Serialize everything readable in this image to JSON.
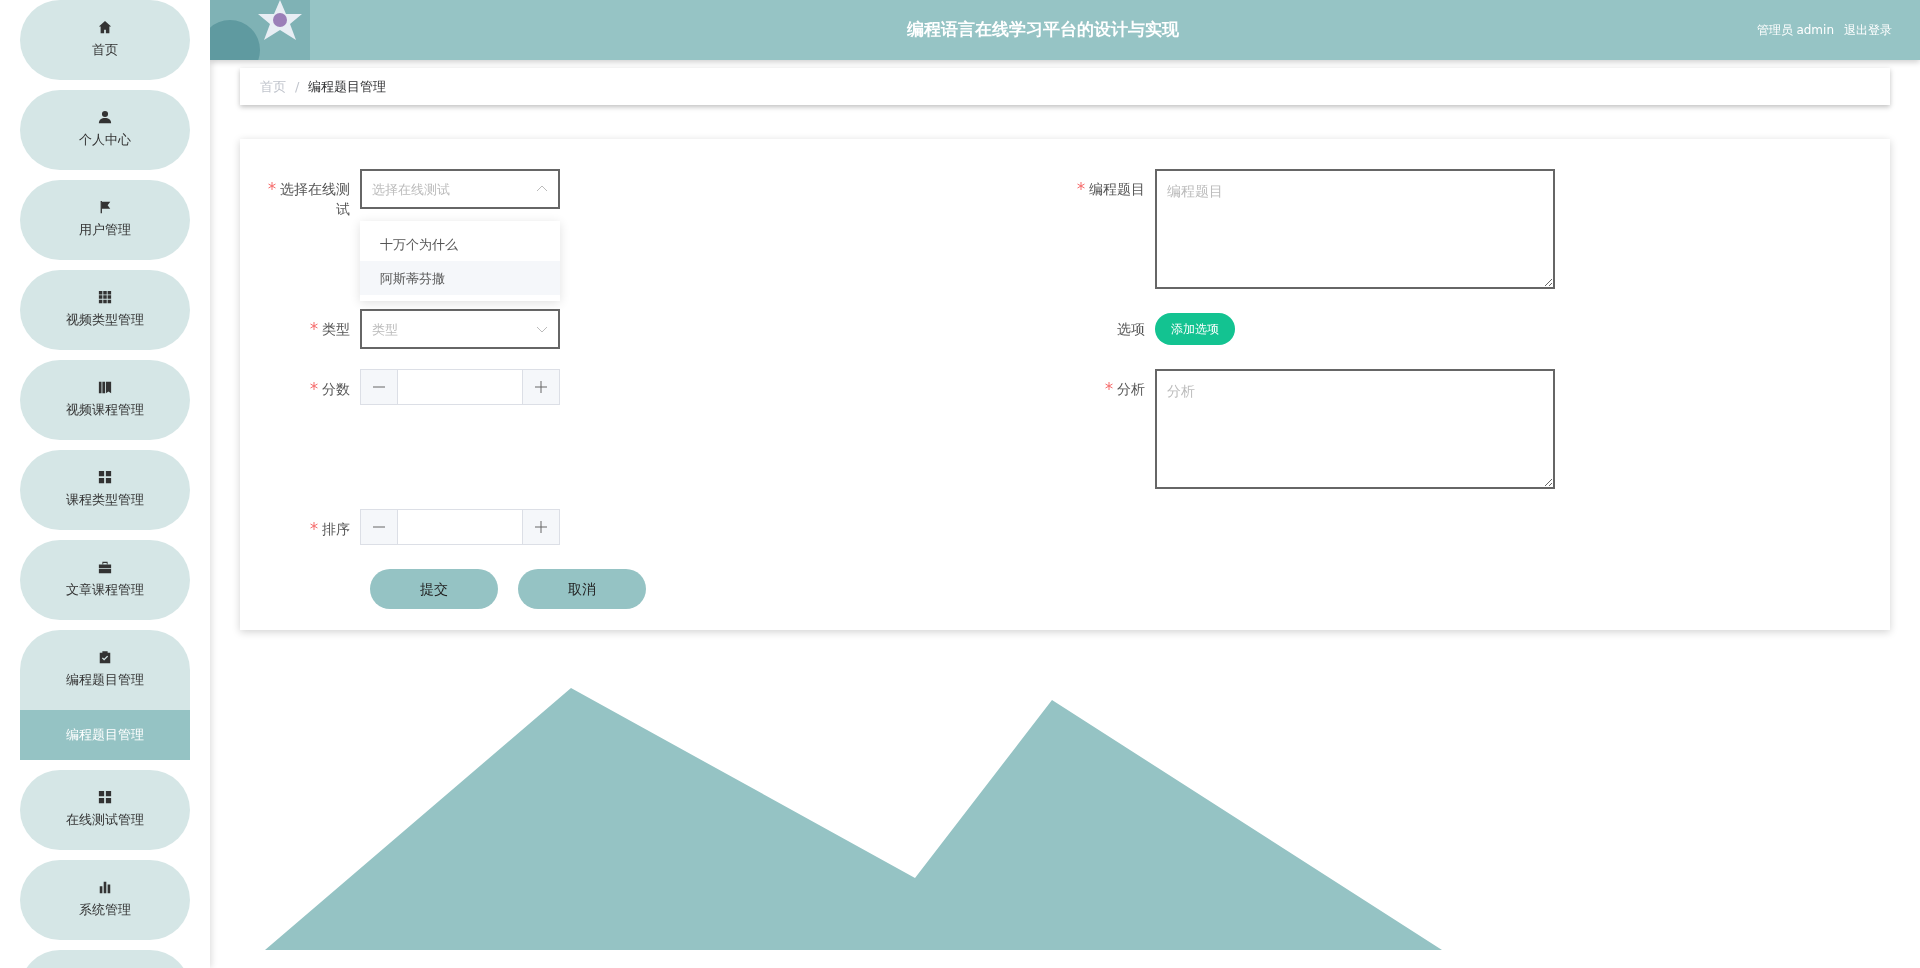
{
  "header": {
    "title": "编程语言在线学习平台的设计与实现",
    "user": "管理员 admin",
    "logout": "退出登录"
  },
  "sidebar": {
    "items": [
      {
        "label": "首页",
        "expanded": false
      },
      {
        "label": "个人中心",
        "expanded": false
      },
      {
        "label": "用户管理",
        "expanded": false
      },
      {
        "label": "视频类型管理",
        "expanded": false
      },
      {
        "label": "视频课程管理",
        "expanded": false
      },
      {
        "label": "课程类型管理",
        "expanded": false
      },
      {
        "label": "文章课程管理",
        "expanded": false
      },
      {
        "label": "编程题目管理",
        "expanded": true,
        "children": [
          {
            "label": "编程题目管理",
            "selected": true
          }
        ]
      },
      {
        "label": "在线测试管理",
        "expanded": false
      },
      {
        "label": "系统管理",
        "expanded": false
      }
    ]
  },
  "breadcrumb": [
    {
      "label": "首页",
      "current": false
    },
    {
      "label": "编程题目管理",
      "current": true
    }
  ],
  "breadcrumb_separator": "/",
  "form": {
    "rows": [
      {
        "left": {
          "kind": "select",
          "label": "选择在线测试",
          "required": true,
          "placeholder": "选择在线测试",
          "open": true,
          "options": [
            {
              "label": "十万个为什么",
              "highlighted": false
            },
            {
              "label": "阿斯蒂芬撒",
              "highlighted": true
            }
          ]
        },
        "right": {
          "kind": "textarea",
          "label": "编程题目",
          "required": true,
          "placeholder": "编程题目"
        }
      },
      {
        "left": {
          "kind": "select",
          "label": "类型",
          "required": true,
          "placeholder": "类型",
          "open": false
        },
        "right": {
          "kind": "button",
          "label": "选项",
          "required": false,
          "button": "添加选项"
        }
      },
      {
        "left": {
          "kind": "number",
          "label": "分数",
          "required": true
        },
        "right": {
          "kind": "textarea",
          "label": "分析",
          "required": true,
          "placeholder": "分析"
        }
      },
      {
        "left": {
          "kind": "number",
          "label": "排序",
          "required": true
        }
      }
    ],
    "buttons": [
      "提交",
      "取消"
    ]
  }
}
